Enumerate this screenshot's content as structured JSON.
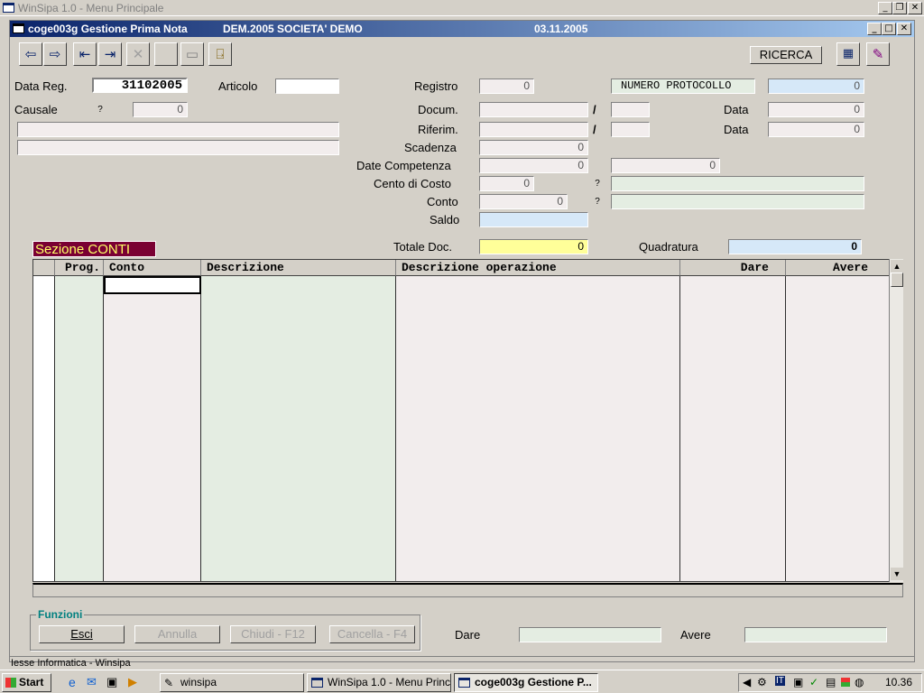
{
  "window": {
    "title": "WinSipa 1.0 - Menu Principale",
    "controls": [
      "_",
      "❐",
      "✕"
    ]
  },
  "child": {
    "code": "coge003g  Gestione Prima Nota",
    "company": "DEM.2005 SOCIETA' DEMO",
    "date": "03.11.2005",
    "controls": [
      "_",
      "□",
      "✕"
    ]
  },
  "toolbar": {
    "ricerca": "RICERCA"
  },
  "form": {
    "data_reg_label": "Data Reg.",
    "data_reg_value": "31102005",
    "articolo_label": "Articolo",
    "articolo_value": "",
    "causale_label": "Causale",
    "causale_q": "?",
    "causale_value": "0",
    "registro_label": "Registro",
    "registro_value": "0",
    "numero_protocollo": "NUMERO PROTOCOLLO",
    "protocollo_value": "0",
    "docum_label": "Docum.",
    "slash": "/",
    "data_label": "Data",
    "docum_data": "0",
    "riferim_label": "Riferim.",
    "riferim_data": "0",
    "scadenza_label": "Scadenza",
    "scadenza_value": "0",
    "date_competenza_label": "Date Competenza",
    "competenza_1": "0",
    "competenza_2": "0",
    "cento_di_costo_label": "Cento di Costo",
    "cento_value": "0",
    "q": "?",
    "conto_label": "Conto",
    "conto_value": "0",
    "saldo_label": "Saldo",
    "totale_doc_label": "Totale Doc.",
    "totale_doc_value": "0",
    "quadratura_label": "Quadratura",
    "quadratura_value": "0"
  },
  "section": {
    "title": "Sezione CONTI"
  },
  "grid": {
    "columns": [
      "",
      "Prog.",
      "Conto",
      "Descrizione",
      "Descrizione operazione",
      "Dare",
      "Avere"
    ],
    "row_count": 17
  },
  "funzioni": {
    "title": "Funzioni",
    "esci": "Esci",
    "annulla": "Annulla",
    "chiudi": "Chiudi - F12",
    "cancella": "Cancella - F4",
    "dare_label": "Dare",
    "avere_label": "Avere"
  },
  "status": {
    "text": "Iesse Informatica - Winsipa"
  },
  "taskbar": {
    "start": "Start",
    "tasks": [
      "winsipa",
      "WinSipa 1.0 - Menu Princi...",
      "coge003g  Gestione P..."
    ],
    "clock": "10.36"
  }
}
